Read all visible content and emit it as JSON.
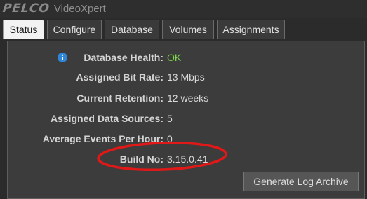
{
  "app": {
    "brand": "PELCO",
    "name": "VideoXpert"
  },
  "tabs": [
    {
      "label": "Status",
      "active": true
    },
    {
      "label": "Configure",
      "active": false
    },
    {
      "label": "Database",
      "active": false
    },
    {
      "label": "Volumes",
      "active": false
    },
    {
      "label": "Assignments",
      "active": false
    }
  ],
  "status": {
    "database_health": {
      "label": "Database Health:",
      "value": "OK",
      "icon": "info-icon"
    },
    "assigned_bit_rate": {
      "label": "Assigned Bit Rate:",
      "value": "13 Mbps"
    },
    "current_retention": {
      "label": "Current Retention:",
      "value": "12 weeks"
    },
    "assigned_data_sources": {
      "label": "Assigned Data Sources:",
      "value": "5"
    },
    "average_events_per_hour": {
      "label": "Average Events Per Hour:",
      "value": "0"
    },
    "build_no": {
      "label": "Build No:",
      "value": "3.15.0.41"
    }
  },
  "actions": {
    "generate_log_archive": "Generate Log Archive"
  },
  "colors": {
    "ok": "#7fd94a",
    "annotation": "#e01818",
    "info_icon": "#2f86d6"
  }
}
